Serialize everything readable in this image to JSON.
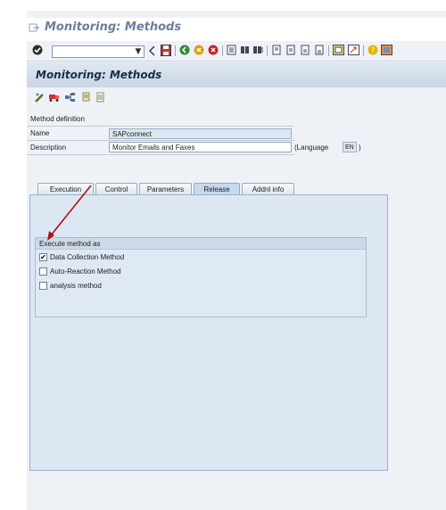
{
  "window": {
    "title": "Monitoring: Methods"
  },
  "toolbar": {
    "command_field_value": "",
    "icons": [
      "enter-icon",
      "back-icon",
      "save-icon",
      "back-green-icon",
      "exit-icon",
      "cancel-icon",
      "print-icon",
      "find-icon",
      "find-next-icon",
      "first-page-icon",
      "previous-page-icon",
      "next-page-icon",
      "last-page-icon",
      "create-session-icon",
      "shortcut-icon",
      "help-icon",
      "layout-menu-icon"
    ]
  },
  "screen": {
    "title": "Monitoring: Methods"
  },
  "app_toolbar": {
    "icons": [
      "edit-pencil-icon",
      "transport-truck-icon",
      "hierarchy-icon",
      "copy-doc-icon",
      "document-icon"
    ]
  },
  "form": {
    "section_label": "Method definition",
    "name_label": "Name",
    "name_value": "SAPconnect",
    "description_label": "Description",
    "description_value": "Monitor Emails and Faxes",
    "language_label": "(Language",
    "language_value": "EN",
    "language_close": ")"
  },
  "tabs": [
    {
      "label": "Execution",
      "active": false
    },
    {
      "label": "Control",
      "active": false
    },
    {
      "label": "Parameters",
      "active": false
    },
    {
      "label": "Release",
      "active": true
    },
    {
      "label": "Addnl info",
      "active": false
    }
  ],
  "group": {
    "title": "Execute method as",
    "options": [
      {
        "label": "Data Collection Method",
        "checked": true
      },
      {
        "label": "Auto-Reaction Method",
        "checked": false
      },
      {
        "label": "analysis method",
        "checked": false
      }
    ]
  },
  "colors": {
    "annotation_arrow": "#b01010",
    "header_text": "#1b2c48"
  }
}
